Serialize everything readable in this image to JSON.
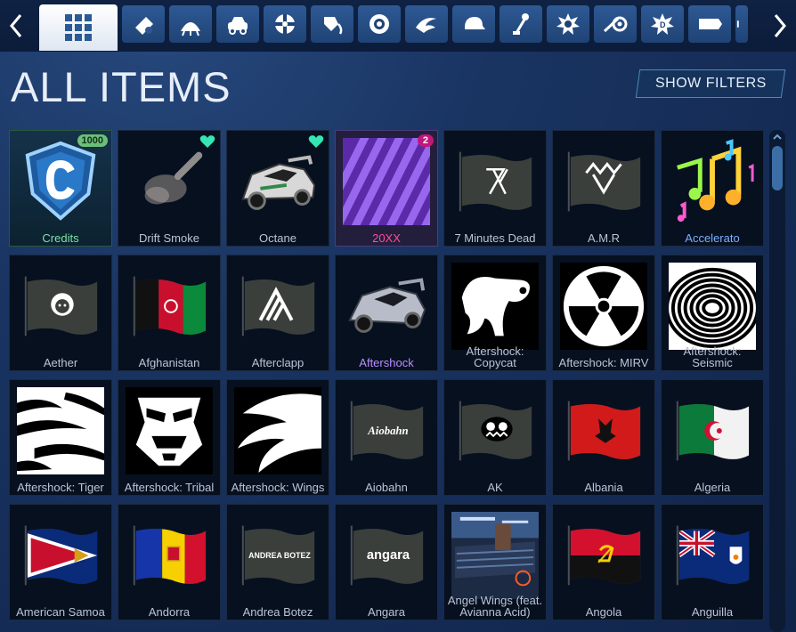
{
  "page": {
    "title": "ALL ITEMS",
    "show_filters_label": "SHOW FILTERS"
  },
  "nav": {
    "categories": [
      {
        "name": "all-items",
        "icon": "grid-icon",
        "active": true
      },
      {
        "name": "bodies-decals",
        "icon": "decal-icon"
      },
      {
        "name": "toppers",
        "icon": "topper-icon"
      },
      {
        "name": "cars",
        "icon": "car-icon"
      },
      {
        "name": "wheels",
        "icon": "wheel-icon"
      },
      {
        "name": "paint-finishes",
        "icon": "paint-icon"
      },
      {
        "name": "boosts",
        "icon": "boost-icon"
      },
      {
        "name": "trails",
        "icon": "trail-icon"
      },
      {
        "name": "hats",
        "icon": "cap-icon"
      },
      {
        "name": "antennas",
        "icon": "antenna-icon"
      },
      {
        "name": "goal-explosions",
        "icon": "explosion-icon"
      },
      {
        "name": "engine-audio",
        "icon": "engine-icon"
      },
      {
        "name": "player-banners",
        "icon": "banner-icon"
      },
      {
        "name": "avatar-borders",
        "icon": "border-icon"
      },
      {
        "name": "more",
        "icon": "more-icon"
      }
    ]
  },
  "items": [
    {
      "name": "Credits",
      "kind": "credits",
      "badge": "1000",
      "label_color": "green"
    },
    {
      "name": "Drift Smoke",
      "kind": "smoke",
      "favorite": true
    },
    {
      "name": "Octane",
      "kind": "car",
      "favorite": true
    },
    {
      "name": "20XX",
      "kind": "painted",
      "badge": "2",
      "label_color": "pink"
    },
    {
      "name": "7 Minutes Dead",
      "kind": "flag",
      "flag": "7md"
    },
    {
      "name": "A.M.R",
      "kind": "flag",
      "flag": "amr"
    },
    {
      "name": "Accelerato",
      "kind": "notes",
      "label_color": "blue"
    },
    {
      "name": "Aether",
      "kind": "flag",
      "flag": "aether"
    },
    {
      "name": "Afghanistan",
      "kind": "flag",
      "flag": "afghanistan"
    },
    {
      "name": "Afterclapp",
      "kind": "flag",
      "flag": "afterclapp"
    },
    {
      "name": "Aftershock",
      "kind": "car2",
      "label_color": "purple"
    },
    {
      "name": "Aftershock: Copycat",
      "kind": "decal",
      "decal": "copycat"
    },
    {
      "name": "Aftershock: MIRV",
      "kind": "decal",
      "decal": "mirv"
    },
    {
      "name": "Aftershock: Seismic",
      "kind": "decal",
      "decal": "seismic"
    },
    {
      "name": "Aftershock: Tiger",
      "kind": "decal",
      "decal": "tiger"
    },
    {
      "name": "Aftershock: Tribal",
      "kind": "decal",
      "decal": "tribal"
    },
    {
      "name": "Aftershock: Wings",
      "kind": "decal",
      "decal": "wings"
    },
    {
      "name": "Aiobahn",
      "kind": "flag",
      "flag": "aiobahn"
    },
    {
      "name": "AK",
      "kind": "flag",
      "flag": "ak"
    },
    {
      "name": "Albania",
      "kind": "flag",
      "flag": "albania"
    },
    {
      "name": "Algeria",
      "kind": "flag",
      "flag": "algeria"
    },
    {
      "name": "American Samoa",
      "kind": "flag",
      "flag": "samoa"
    },
    {
      "name": "Andorra",
      "kind": "flag",
      "flag": "andorra"
    },
    {
      "name": "Andrea Botez",
      "kind": "flag",
      "flag": "botez",
      "flag_text": "ANDREA BOTEZ"
    },
    {
      "name": "Angara",
      "kind": "flag",
      "flag": "angara",
      "flag_text": "angara"
    },
    {
      "name": "Angel Wings (feat. Avianna Acid)",
      "kind": "music"
    },
    {
      "name": "Angola",
      "kind": "flag",
      "flag": "angola"
    },
    {
      "name": "Anguilla",
      "kind": "flag",
      "flag": "anguilla"
    }
  ],
  "aiobahn_text": "Aiobahn",
  "colors": {
    "accent": "#3c6ea6",
    "credits_badge": "#6bbf78",
    "paint_badge": "#c2167a",
    "favorite": "#35e6b4"
  }
}
